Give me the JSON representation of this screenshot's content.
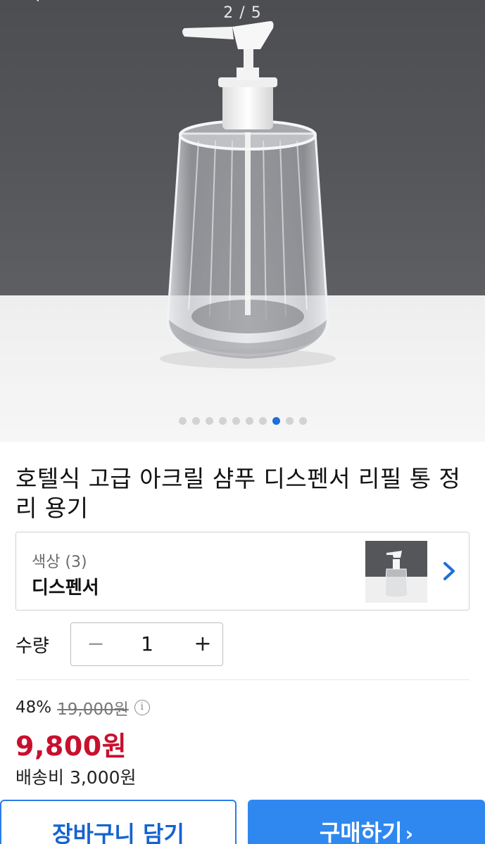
{
  "gallery": {
    "counter": "2 / 5",
    "dot_count": 10,
    "active_dot_index": 7
  },
  "product": {
    "title": "호텔식 고급 아크릴 샴푸 디스펜서 리필 통 정리 용기"
  },
  "option": {
    "label": "색상 (3)",
    "value": "디스펜서"
  },
  "quantity": {
    "label": "수량",
    "value": "1",
    "minus": "−",
    "plus": "+"
  },
  "price": {
    "discount_rate": "48%",
    "original": "19,000원",
    "sale": "9,800원",
    "shipping": "배송비 3,000원"
  },
  "actions": {
    "cart_label": "장바구니 담기",
    "buy_label": "구매하기"
  },
  "colors": {
    "accent": "#2f88f0",
    "sale_price": "#c8102e",
    "active_dot": "#1e6fd9"
  },
  "icons": {
    "back": "back-arrow-icon",
    "option_next": "chevron-right-icon",
    "info": "info-icon"
  }
}
